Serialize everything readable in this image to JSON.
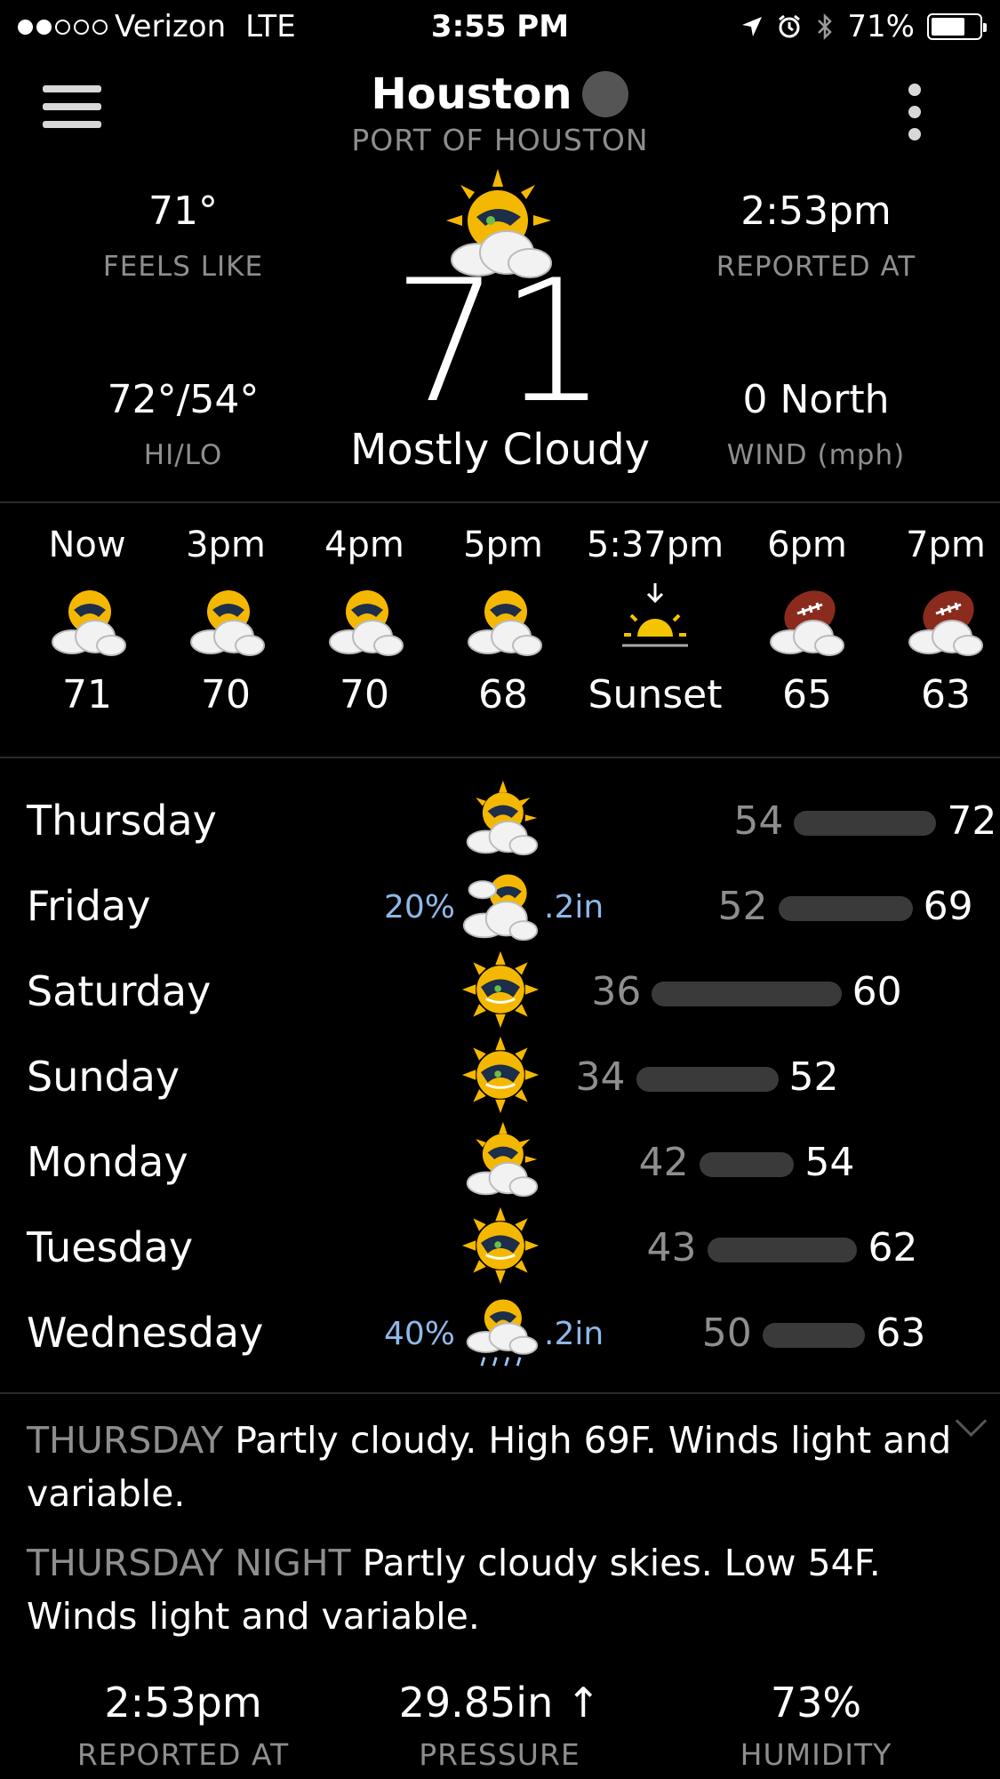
{
  "status_bar": {
    "carrier": "Verizon",
    "network": "LTE",
    "time": "3:55 PM",
    "battery": "71%",
    "battery_level": 0.71,
    "signal_bars": 2
  },
  "header": {
    "city": "Houston",
    "station": "PORT OF HOUSTON"
  },
  "current": {
    "feels_like_value": "71°",
    "feels_like_label": "FEELS LIKE",
    "reported_value": "2:53pm",
    "reported_label": "REPORTED AT",
    "hilo_value": "72°/54°",
    "hilo_label": "HI/LO",
    "wind_value": "0 North",
    "wind_label": "WIND (mph)",
    "temperature": "71",
    "condition": "Mostly Cloudy",
    "icon": "partly-cloudy-sun-icon"
  },
  "hourly": [
    {
      "time": "Now",
      "value": "71",
      "icon": "partly-cloudy-sun-icon"
    },
    {
      "time": "3pm",
      "value": "70",
      "icon": "partly-cloudy-sun-icon"
    },
    {
      "time": "4pm",
      "value": "70",
      "icon": "partly-cloudy-sun-icon"
    },
    {
      "time": "5pm",
      "value": "68",
      "icon": "partly-cloudy-sun-icon"
    },
    {
      "time": "5:37pm",
      "value": "Sunset",
      "icon": "sunset-icon"
    },
    {
      "time": "6pm",
      "value": "65",
      "icon": "partly-cloudy-moon-icon"
    },
    {
      "time": "7pm",
      "value": "63",
      "icon": "partly-cloudy-moon-icon"
    }
  ],
  "daily": [
    {
      "day": "Thursday",
      "precip_chance": "",
      "precip_amount": "",
      "low": "54",
      "high": "72",
      "icon": "partly-cloudy-sun-icon"
    },
    {
      "day": "Friday",
      "precip_chance": "20%",
      "precip_amount": ".2in",
      "low": "52",
      "high": "69",
      "icon": "cloudy-sun-icon"
    },
    {
      "day": "Saturday",
      "precip_chance": "",
      "precip_amount": "",
      "low": "36",
      "high": "60",
      "icon": "sunny-icon"
    },
    {
      "day": "Sunday",
      "precip_chance": "",
      "precip_amount": "",
      "low": "34",
      "high": "52",
      "icon": "sunny-icon"
    },
    {
      "day": "Monday",
      "precip_chance": "",
      "precip_amount": "",
      "low": "42",
      "high": "54",
      "icon": "partly-cloudy-sun-icon"
    },
    {
      "day": "Tuesday",
      "precip_chance": "",
      "precip_amount": "",
      "low": "43",
      "high": "62",
      "icon": "sunny-icon"
    },
    {
      "day": "Wednesday",
      "precip_chance": "40%",
      "precip_amount": ".2in",
      "low": "50",
      "high": "63",
      "icon": "rain-sun-icon"
    }
  ],
  "forecast_text": [
    {
      "label": "THURSDAY",
      "text": "Partly cloudy. High 69F. Winds light and variable."
    },
    {
      "label": "THURSDAY NIGHT",
      "text": "Partly cloudy skies. Low 54F. Winds light and variable."
    }
  ],
  "bottom_stats": [
    {
      "value": "2:53pm",
      "label": "REPORTED AT"
    },
    {
      "value": "29.85in ↑",
      "label": "PRESSURE"
    },
    {
      "value": "73%",
      "label": "HUMIDITY"
    }
  ],
  "colors": {
    "background": "#000000",
    "secondary_text": "#8e8e8e",
    "precip_blue": "#8fb8e8",
    "sun": "#f5b800",
    "range_bar": "#3a3a3a"
  }
}
